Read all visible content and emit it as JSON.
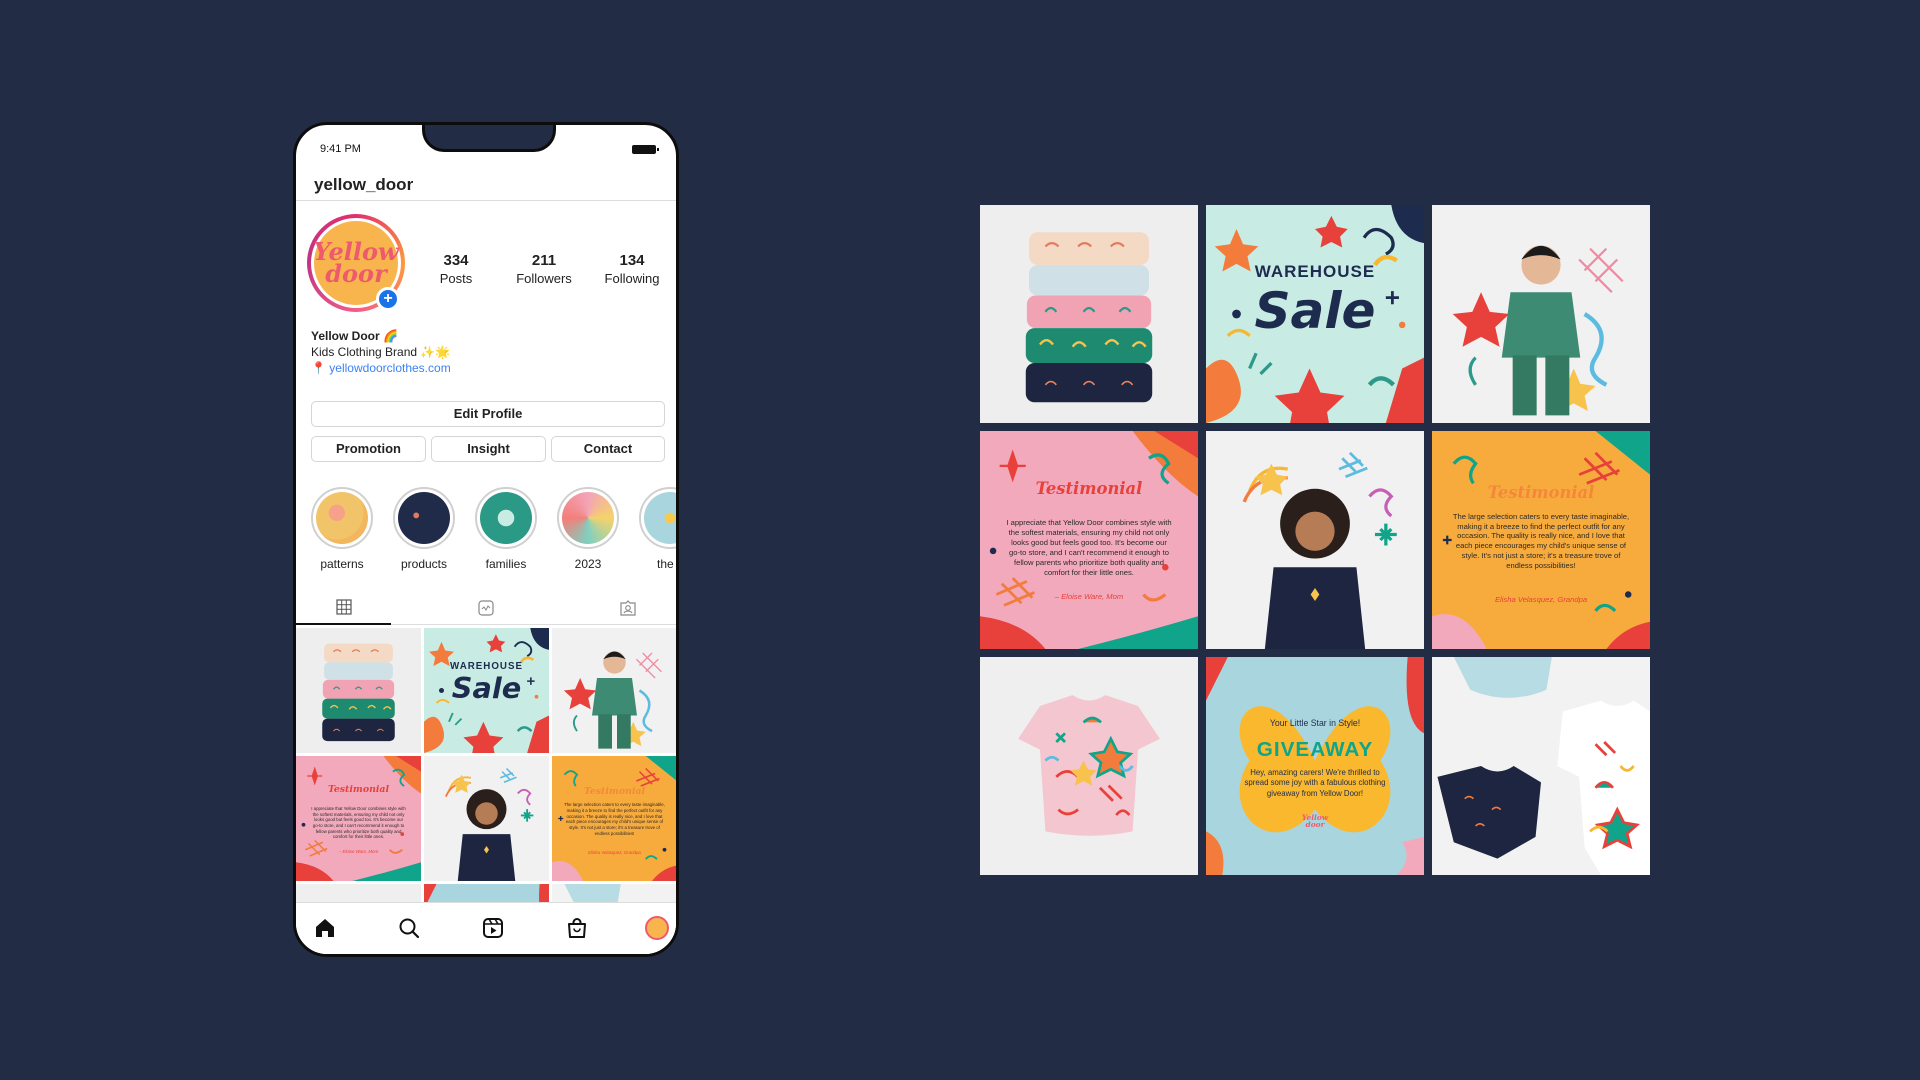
{
  "status": {
    "time": "9:41 PM"
  },
  "profile": {
    "username": "yellow_door",
    "avatar_text": [
      "Yellow",
      "door"
    ],
    "stats": [
      {
        "value": "334",
        "label": "Posts"
      },
      {
        "value": "211",
        "label": "Followers"
      },
      {
        "value": "134",
        "label": "Following"
      }
    ],
    "bio": {
      "name": "Yellow Door 🌈",
      "tagline": "Kids Clothing Brand ✨🌟",
      "pin": "📍",
      "link": "yellowdoorclothes.com"
    },
    "buttons": {
      "edit_profile": "Edit Profile",
      "promotion": "Promotion",
      "insight": "Insight",
      "contact": "Contact"
    },
    "highlights": [
      {
        "label": "patterns",
        "color": "#f2b75e"
      },
      {
        "label": "products",
        "color": "#1f2b48"
      },
      {
        "label": "families",
        "color": "#2a9a86"
      },
      {
        "label": "2023",
        "color": "#f3a4b8"
      },
      {
        "label": "the k",
        "color": "#a9d6de"
      }
    ],
    "tabs": [
      "grid-icon",
      "reels-icon",
      "tagged-icon"
    ],
    "nav": [
      "home-icon",
      "search-icon",
      "reels-icon",
      "shop-icon",
      "profile-icon"
    ]
  },
  "posts": {
    "sale": {
      "line1": "WAREHOUSE",
      "line2": "Sale"
    },
    "testimonial1": {
      "title": "Testimonial",
      "body": "I appreciate that Yellow Door combines style with the softest materials, ensuring my child not only looks good but feels good too. It's become our go-to store, and I can't recommend it enough to fellow parents who prioritize both quality and comfort for their little ones.",
      "author": "– Eloise Ware, Mom"
    },
    "testimonial2": {
      "title": "Testimonial",
      "body": "The large selection caters to every taste imaginable, making it a breeze to find the perfect outfit for any occasion. The quality is really nice, and I love that each piece encourages my child's unique sense of style. It's not just a store; it's a treasure trove of endless possibilities!",
      "author": "Elisha Velasquez, Grandpa"
    },
    "giveaway": {
      "sub": "Your Little Star in Style!",
      "title": "GIVEAWAY",
      "body": "Hey, amazing carers! We're thrilled to spread some joy with a fabulous clothing giveaway from Yellow Door!",
      "logo": [
        "Yellow",
        "door"
      ]
    }
  },
  "colors": {
    "background": "#232c45",
    "accent_blue": "#1a73e8",
    "brand_yellow": "#f9b54d",
    "brand_pink": "#ee5a6d",
    "mint": "#c8ece3",
    "pink_bg": "#f3a9bc",
    "orange_bg": "#f8ab3d",
    "sky_blue": "#a9d6de"
  }
}
